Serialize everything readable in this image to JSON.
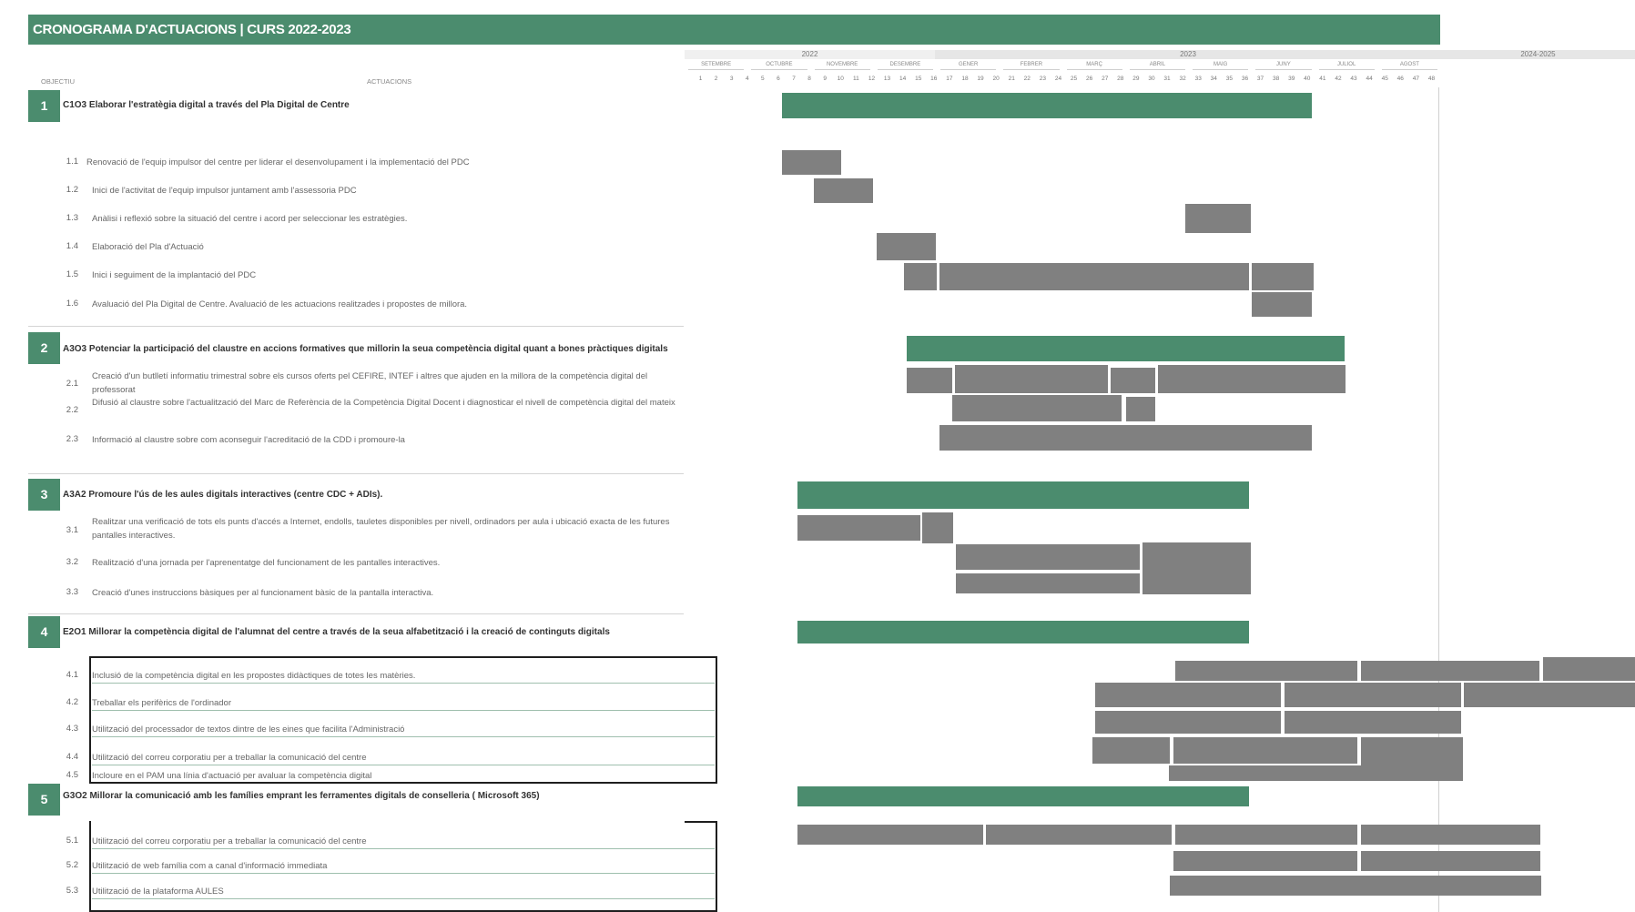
{
  "title": "CRONOGRAMA D'ACTUACIONS | CURS 2022-2023",
  "headers": {
    "objective": "OBJECTIU",
    "actions": "ACTUACIONS"
  },
  "timeline": {
    "years": [
      "2022",
      "2023",
      "2024-2025"
    ],
    "months": [
      "SETEMBRE",
      "OCTUBRE",
      "NOVEMBRE",
      "DESEMBRE",
      "GENER",
      "FEBRER",
      "MARÇ",
      "ABRIL",
      "MAIG",
      "JUNY",
      "JULIOL",
      "AGOST"
    ],
    "weeks": [
      "1",
      "2",
      "3",
      "4",
      "5",
      "6",
      "7",
      "8",
      "9",
      "10",
      "11",
      "12",
      "13",
      "14",
      "15",
      "16",
      "17",
      "18",
      "19",
      "20",
      "21",
      "22",
      "23",
      "24",
      "25",
      "26",
      "27",
      "28",
      "29",
      "30",
      "31",
      "32",
      "33",
      "34",
      "35",
      "36",
      "37",
      "38",
      "39",
      "40",
      "41",
      "42",
      "43",
      "44",
      "45",
      "46",
      "47",
      "48"
    ]
  },
  "colors": {
    "accent": "#4b8c6e",
    "task_bar": "#808080"
  },
  "objectives": [
    {
      "number": "1",
      "title": "C1O3 Elaborar l'estratègia digital a través del Pla Digital de Centre",
      "actions": [
        {
          "number": "1.1",
          "text": "Renovació de l'equip impulsor del centre per liderar el desenvolupament i la implementació del PDC"
        },
        {
          "number": "1.2",
          "text": "Inici de l'activitat de l'equip impulsor juntament amb l'assessoria PDC"
        },
        {
          "number": "1.3",
          "text": "Anàlisi i reflexió sobre la situació del centre i acord per seleccionar les estratègies."
        },
        {
          "number": "1.4",
          "text": "Elaboració del Pla d'Actuació"
        },
        {
          "number": "1.5",
          "text": "Inici i seguiment de la implantació del PDC"
        },
        {
          "number": "1.6",
          "text": "Avaluació del Pla Digital de Centre. Avaluació de les actuacions realitzades i propostes de millora."
        }
      ]
    },
    {
      "number": "2",
      "title": "A3O3 Potenciar la participació del claustre en accions formatives que millorin la seua competència digital quant a bones pràctiques digitals",
      "actions": [
        {
          "number": "2.1",
          "text": "Creació d'un butlletí informatiu trimestral sobre els cursos oferts pel CEFIRE, INTEF i altres que ajuden en la millora de la competència digital del professorat"
        },
        {
          "number": "2.2",
          "text": "Difusió al claustre sobre l'actualització del Marc de Referència de la Competència Digital Docent i diagnosticar el nivell de competència digital del mateix"
        },
        {
          "number": "2.3",
          "text": "Informació al claustre sobre com aconseguir l'acreditació de la CDD i promoure-la"
        }
      ]
    },
    {
      "number": "3",
      "title": "A3A2 Promoure l'ús de les aules digitals interactives (centre CDC + ADIs).",
      "actions": [
        {
          "number": "3.1",
          "text": "Realitzar una verificació de tots els punts d'accés a Internet, endolls, tauletes disponibles per nivell, ordinadors per aula i ubicació exacta de les futures pantalles interactives."
        },
        {
          "number": "3.2",
          "text": "Realització d'una jornada per l'aprenentatge del funcionament de les pantalles interactives."
        },
        {
          "number": "3.3",
          "text": "Creació d'unes instruccions bàsiques per al funcionament bàsic de la pantalla interactiva."
        }
      ]
    },
    {
      "number": "4",
      "title": "E2O1 Millorar la competència digital de l'alumnat del centre a través de la seua alfabetització i la creació de continguts digitals",
      "actions": [
        {
          "number": "4.1",
          "text": "Inclusió de la competència digital en les propostes didàctiques de totes les matèries."
        },
        {
          "number": "4.2",
          "text": "Treballar els perifèrics de l'ordinador"
        },
        {
          "number": "4.3",
          "text": "Utilització del processador de textos dintre de les eines que facilita l'Administració"
        },
        {
          "number": "4.4",
          "text": "Utilització del correu corporatiu per a treballar la comunicació del centre"
        },
        {
          "number": "4.5",
          "text": "Incloure en el PAM una línia d'actuació per avaluar la competència digital"
        }
      ]
    },
    {
      "number": "5",
      "title": "G3O2 Millorar la comunicació amb les famílies emprant les ferramentes digitals de conselleria ( Microsoft 365)",
      "actions": [
        {
          "number": "5.1",
          "text": "Utilització del correu corporatiu per a treballar la comunicació del centre"
        },
        {
          "number": "5.2",
          "text": "Utilització de web família com a canal d'informació immediata"
        },
        {
          "number": "5.3",
          "text": "Utilització de la plataforma AULES"
        }
      ]
    }
  ]
}
